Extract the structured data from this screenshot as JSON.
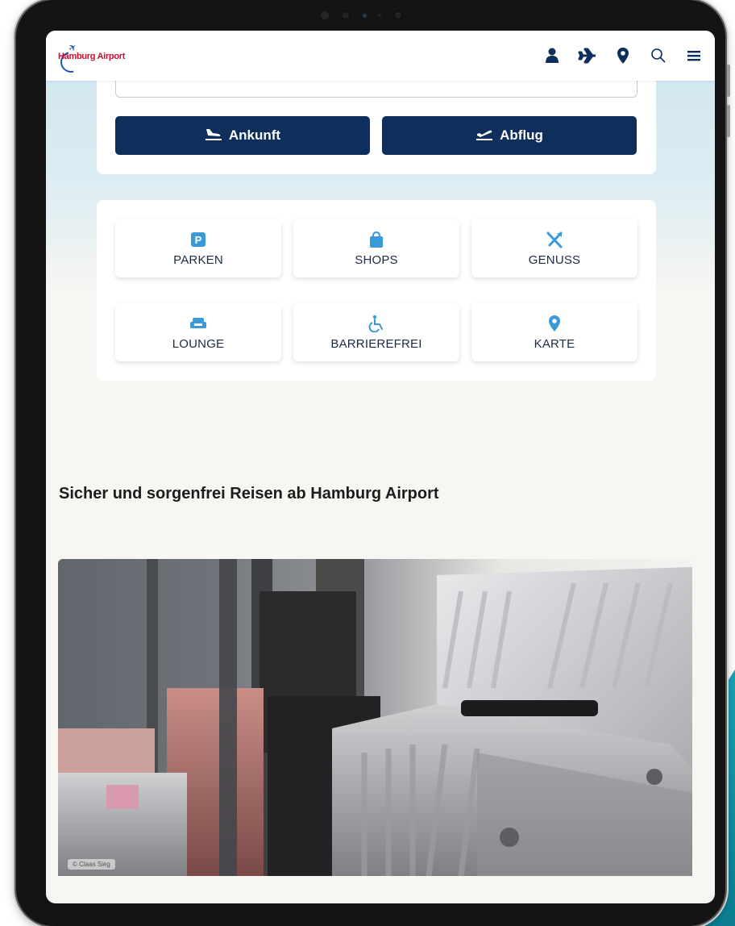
{
  "header": {
    "logo_text": "Hamburg Airport",
    "icons": [
      "user-icon",
      "plane-icon",
      "location-pin-icon",
      "search-icon",
      "menu-icon"
    ]
  },
  "flights": {
    "arrival_label": "Ankunft",
    "departure_label": "Abflug"
  },
  "tiles": [
    {
      "label": "PARKEN",
      "icon": "parking-icon"
    },
    {
      "label": "SHOPS",
      "icon": "shopping-bag-icon"
    },
    {
      "label": "GENUSS",
      "icon": "utensils-icon"
    },
    {
      "label": "LOUNGE",
      "icon": "sofa-icon"
    },
    {
      "label": "BARRIEREFREI",
      "icon": "wheelchair-icon"
    },
    {
      "label": "KARTE",
      "icon": "map-pin-icon"
    }
  ],
  "section": {
    "title": "Sicher und sorgenfrei Reisen ab Hamburg Airport"
  },
  "hero": {
    "credit": "© Claas Sieg"
  },
  "colors": {
    "navy": "#0e2e5c",
    "accent_blue": "#3a9ad9",
    "logo_red": "#c8102e"
  }
}
